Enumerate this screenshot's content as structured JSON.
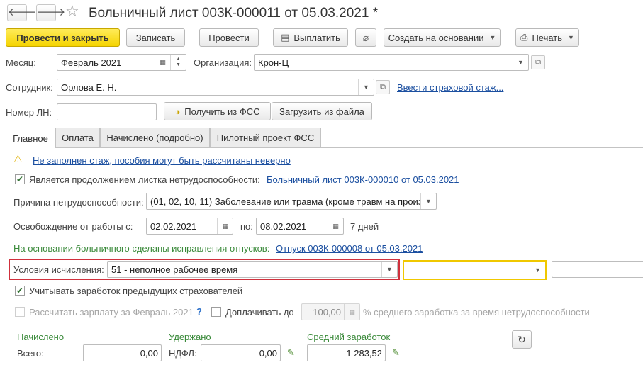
{
  "header": {
    "back_glyph": "🡐",
    "forward_glyph": "🡒",
    "star_glyph": "☆",
    "title": "Больничный лист 003К-000011 от 05.03.2021 *"
  },
  "toolbar": {
    "post_close": "Провести и закрыть",
    "write": "Записать",
    "post": "Провести",
    "pay": "Выплатить",
    "create_based": "Создать на основании",
    "print": "Печать"
  },
  "form": {
    "month_label": "Месяц:",
    "month_value": "Февраль 2021",
    "org_label": "Организация:",
    "org_value": "Крон-Ц",
    "employee_label": "Сотрудник:",
    "employee_value": "Орлова Е. Н.",
    "insurance_link": "Ввести страховой стаж...",
    "ln_label": "Номер ЛН:",
    "ln_value": "",
    "get_fss": "Получить из ФСС",
    "load_file": "Загрузить из файла"
  },
  "tabs": [
    "Главное",
    "Оплата",
    "Начислено (подробно)",
    "Пилотный проект ФСС"
  ],
  "main": {
    "warning_text": "Не заполнен стаж, пособия могут быть рассчитаны неверно",
    "continuation_label": "Является продолжением листка нетрудоспособности:",
    "continuation_link": "Больничный лист 003К-000010 от 05.03.2021",
    "reason_label": "Причина нетрудоспособности:",
    "reason_value": "(01, 02, 10, 11) Заболевание или травма (кроме травм на произв",
    "release_label": "Освобождение от работы с:",
    "date_from": "02.02.2021",
    "to_label": "по:",
    "date_to": "08.02.2021",
    "days": "7 дней",
    "vacation_note": "На основании больничного сделаны исправления отпусков:",
    "vacation_link": "Отпуск 003К-000008 от 05.03.2021",
    "conditions_label": "Условия исчисления:",
    "conditions_value": "51 - неполное рабочее время",
    "consider_prev": "Учитывать заработок предыдущих страхователей",
    "calc_salary": "Рассчитать зарплату за Февраль 2021",
    "help_glyph": "?",
    "extra_pay": "Доплачивать до",
    "extra_value": "100,00",
    "percent_text": "% среднего заработка за время нетрудоспособности"
  },
  "totals": {
    "accrued_header": "Начислено",
    "total_label": "Всего:",
    "total_value": "0,00",
    "withheld_header": "Удержано",
    "ndfl_label": "НДФЛ:",
    "ndfl_value": "0,00",
    "avg_header": "Средний заработок",
    "avg_value": "1 283,52"
  }
}
